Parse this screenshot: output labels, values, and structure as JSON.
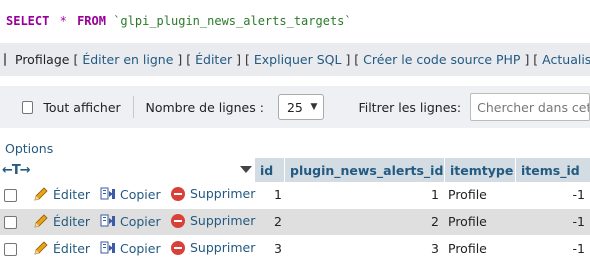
{
  "sql": {
    "select": "SELECT",
    "star": "*",
    "from": "FROM",
    "table": "`glpi_plugin_news_alerts_targets`"
  },
  "profiling": {
    "label": "Profilage",
    "links": [
      "Éditer en ligne",
      "Éditer",
      "Expliquer SQL",
      "Créer le code source PHP",
      "Actualiser"
    ]
  },
  "nav": {
    "show_all": "Tout afficher",
    "rows_label": "Nombre de lignes :",
    "rows_value": "25",
    "filter_label": "Filtrer les lignes:",
    "filter_placeholder": "Chercher dans cette table"
  },
  "options_label": "Options",
  "table": {
    "columns": [
      "id",
      "plugin_news_alerts_id",
      "itemtype",
      "items_id"
    ],
    "actions": {
      "edit": "Éditer",
      "copy": "Copier",
      "delete": "Supprimer"
    },
    "rows": [
      {
        "id": "1",
        "alert": "1",
        "itemtype": "Profile",
        "items_id": "-1"
      },
      {
        "id": "2",
        "alert": "2",
        "itemtype": "Profile",
        "items_id": "-1"
      },
      {
        "id": "3",
        "alert": "3",
        "itemtype": "Profile",
        "items_id": "-1"
      }
    ]
  },
  "colors": {
    "link": "#235a81",
    "header_bg": "#d3dce3",
    "row_alt": "#dfdfdf",
    "keyword": "#990099"
  }
}
